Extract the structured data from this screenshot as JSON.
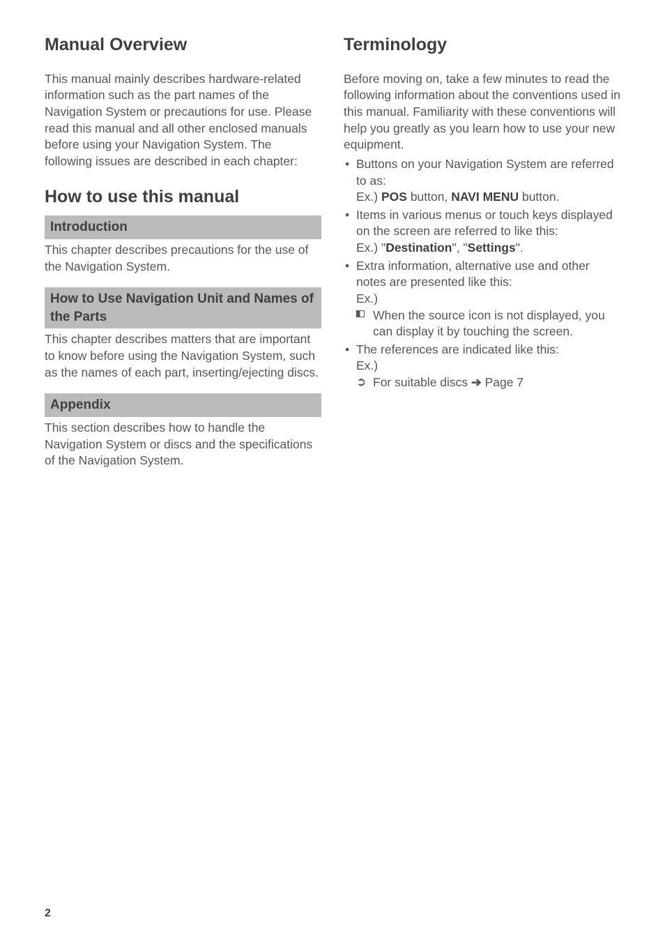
{
  "page_number": "2",
  "left": {
    "h1": "Manual Overview",
    "intro": "This manual mainly describes hardware-related information such as the part names of the Navigation System or precautions for use. Please read this manual and all other enclosed manuals before using your Navigation System. The following issues are described in each chapter:",
    "h2": "How to use this manual",
    "sec1_title": "Introduction",
    "sec1_body": "This chapter describes precautions for the use of the Navigation System.",
    "sec2_title": "How to Use Navigation Unit and Names of the Parts",
    "sec2_body": "This chapter describes matters that are important to know before using the Navigation System, such as the names of each part, inserting/ejecting discs.",
    "sec3_title": "Appendix",
    "sec3_body": "This section describes how to handle the Navigation System or discs and the specifications of the Navigation System."
  },
  "right": {
    "h1": "Terminology",
    "intro": "Before moving on, take a few minutes to read the following information about the conventions used in this manual. Familiarity with these conventions will help you greatly as you learn how to use your new equipment.",
    "b1_line1": "Buttons on your Navigation System are referred to as:",
    "b1_ex_prefix": "Ex.) ",
    "b1_ex_pos": "POS",
    "b1_ex_mid": " button,  ",
    "b1_ex_navi": "NAVI MENU",
    "b1_ex_suffix": " button.",
    "b2_line1": "Items in various menus or touch keys displayed on the screen are referred to like this:",
    "b2_ex_prefix": "Ex.) \"",
    "b2_ex_dest": "Destination",
    "b2_ex_mid": "\", \"",
    "b2_ex_set": "Settings",
    "b2_ex_suffix": "\".",
    "b3_line1": "Extra information, alternative use and other notes are presented like this:",
    "b3_ex": "Ex.)",
    "b3_sub": "When the source icon is not displayed, you can display it by touching the screen.",
    "b4_line1": "The references are indicated like this:",
    "b4_ex": "Ex.)",
    "b4_sub_prefix": "For suitable discs ",
    "b4_sub_arrow": "➔",
    "b4_sub_suffix": " Page 7"
  }
}
